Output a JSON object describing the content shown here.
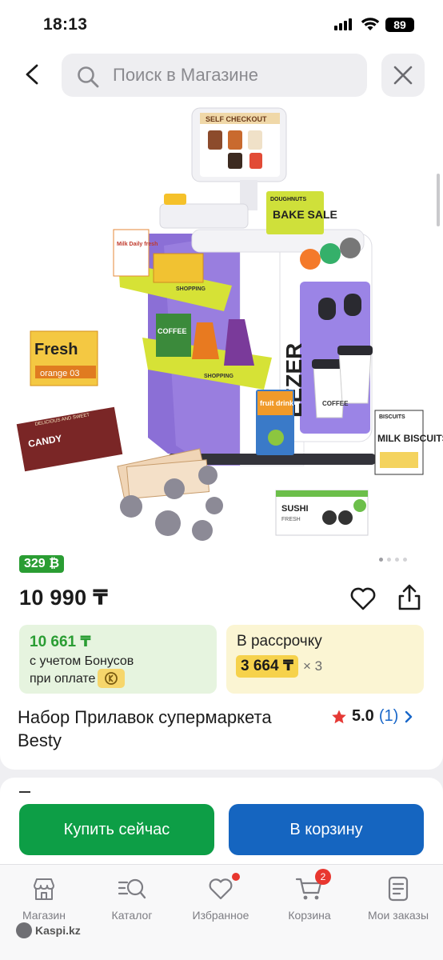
{
  "status_bar": {
    "time": "18:13",
    "battery": "89"
  },
  "header": {
    "search_placeholder": "Поиск в Магазине"
  },
  "gallery": {
    "screen_label": "SELF CHECKOUT",
    "bake_sale": "BAKE SALE",
    "doughnuts": "DOUGHNUTS",
    "freezer": "EEZER",
    "shopping": "SHOPPING",
    "fresh_box": "Fresh",
    "fresh_box_sub": "orange 03",
    "candy_box": "CANDY",
    "candy_box_sub": "DELICIOUS AND SWEET",
    "biscuits_box": "MILK BISCUITS",
    "biscuits_tag": "BISCUITS",
    "sushi_box": "SUSHI",
    "sushi_sub": "FRESH",
    "fruit_drink": "fruit drink",
    "coffee_box": "COFFEE",
    "milk_box": "Milk Daily fresh",
    "cup_label": "COFFEE",
    "page_index": 0,
    "page_count": 4
  },
  "product": {
    "bonus_badge": "329 ₿",
    "price": "10 990 ₸",
    "bonus_price": "10 661 ₸",
    "bonus_line1": "с учетом Бонусов",
    "bonus_line2": "при оплате",
    "credit_title": "В рассрочку",
    "credit_amount": "3 664 ₸",
    "credit_multiplier": "× 3",
    "title": "Набор Прилавок супермаркета Besty",
    "rating": "5.0",
    "reviews": "(1)"
  },
  "actions": {
    "buy_now": "Купить сейчас",
    "add_to_cart": "В корзину"
  },
  "tabbar": {
    "items": [
      {
        "label": "Магазин",
        "icon": "shop-icon"
      },
      {
        "label": "Каталог",
        "icon": "catalog-search-icon"
      },
      {
        "label": "Избранное",
        "icon": "heart-icon"
      },
      {
        "label": "Корзина",
        "icon": "cart-icon",
        "badge": "2"
      },
      {
        "label": "Мои заказы",
        "icon": "orders-icon"
      }
    ]
  },
  "brand": "Kaspi.kz",
  "colors": {
    "green": "#0d9e46",
    "blue": "#1565c0",
    "bonus_green": "#2a9d33",
    "credit_yellow": "#f6d24b",
    "badge_red": "#e8372f",
    "link_blue": "#1967c9"
  }
}
